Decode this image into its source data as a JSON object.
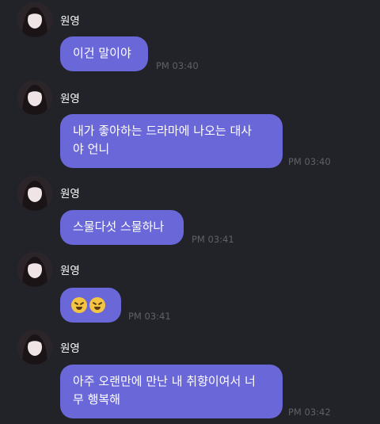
{
  "messages": [
    {
      "sender": "원영",
      "text_lines": [
        "이건 말이야"
      ],
      "time": "PM 03:40"
    },
    {
      "sender": "원영",
      "text_lines": [
        "내가 좋아하는 드라마에 나오는 대사",
        "야 언니"
      ],
      "time": "PM 03:40"
    },
    {
      "sender": "원영",
      "text_lines": [
        "스물다섯 스물하나"
      ],
      "time": "PM 03:41"
    },
    {
      "sender": "원영",
      "emojis": [
        "persevering-face-emoji",
        "persevering-face-emoji"
      ],
      "time": "PM 03:41"
    },
    {
      "sender": "원영",
      "text_lines": [
        "아주 오랜만에 만난 내 취향이여서 너",
        "무 행복해"
      ],
      "time": "PM 03:42"
    }
  ],
  "colors": {
    "background": "#222328",
    "bubble": "#6a67d8",
    "timestamp": "#5f6068"
  }
}
